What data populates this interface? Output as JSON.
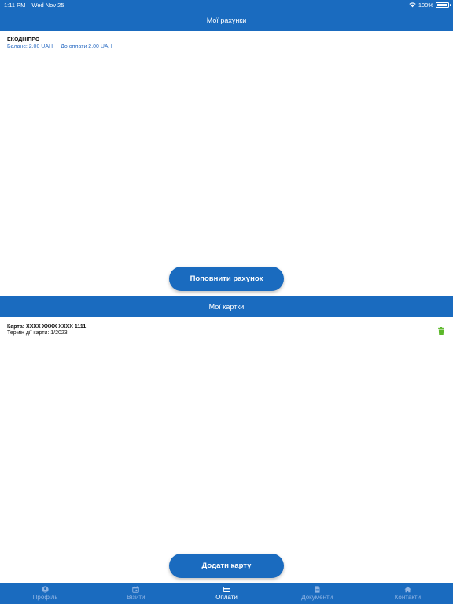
{
  "status_bar": {
    "time": "1:11 PM",
    "date": "Wed Nov 25",
    "battery": "100%"
  },
  "accounts": {
    "header_title": "Мої рахунки",
    "items": [
      {
        "name": "ЕКОДНІПРО",
        "balance": "Баланс: 2.00 UAH",
        "due": "До оплати 2.00 UAH"
      }
    ],
    "topup_label": "Поповнити рахунок"
  },
  "cards": {
    "header_title": "Мої картки",
    "items": [
      {
        "number": "Карта: XXXX XXXX XXXX 1111",
        "expiry": "Термін дії карти: 1/2023"
      }
    ],
    "add_label": "Додати карту",
    "trash_color": "#5cb82a"
  },
  "tabs": [
    {
      "label": "Профіль",
      "icon": "profile-icon",
      "active": false
    },
    {
      "label": "Візити",
      "icon": "calendar-icon",
      "active": false
    },
    {
      "label": "Оплати",
      "icon": "credit-card-icon",
      "active": true
    },
    {
      "label": "Документи",
      "icon": "document-icon",
      "active": false
    },
    {
      "label": "Контакти",
      "icon": "home-icon",
      "active": false
    }
  ],
  "colors": {
    "primary": "#1a6bbf",
    "link": "#2f6fc4",
    "inactive_tab": "#8fb4e3"
  }
}
